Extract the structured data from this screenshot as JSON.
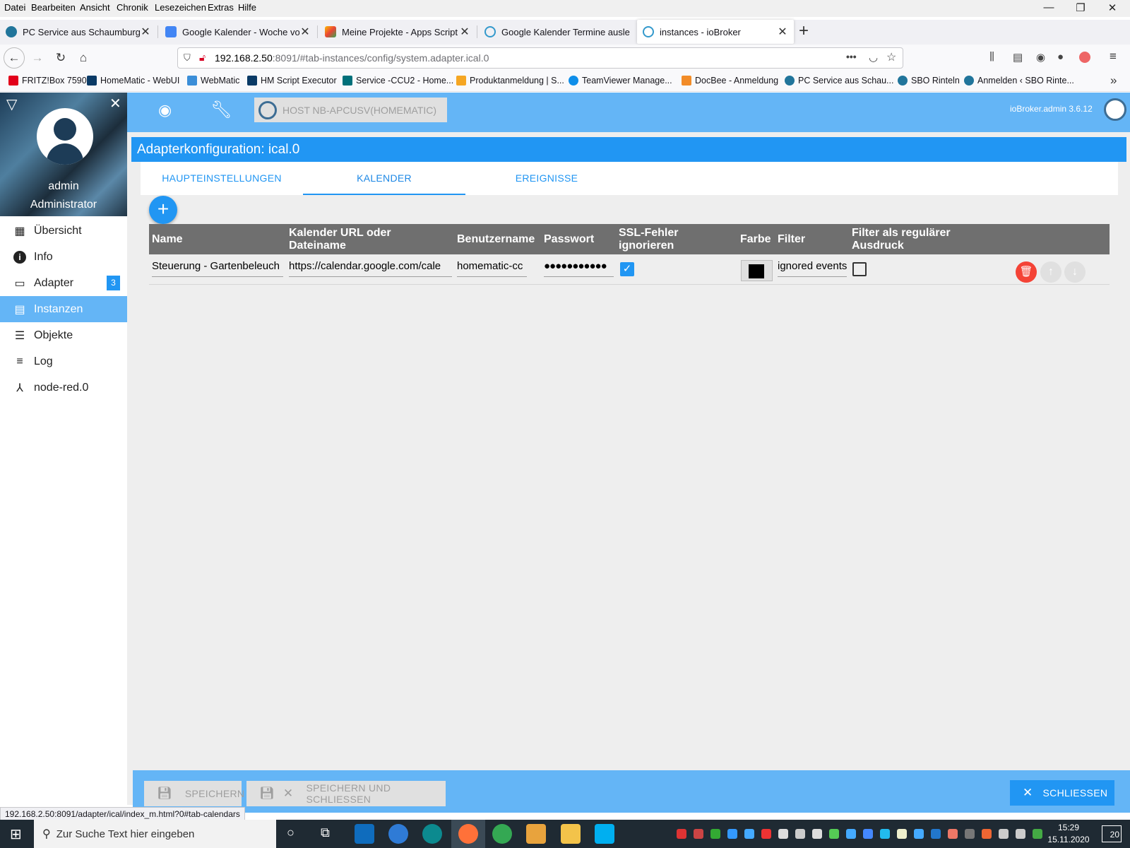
{
  "menubar": {
    "items": [
      "Datei",
      "Bearbeiten",
      "Ansicht",
      "Chronik",
      "Lesezeichen",
      "Extras",
      "Hilfe"
    ]
  },
  "window_controls": {
    "minimize": "—",
    "restore": "❐",
    "close": "✕"
  },
  "tabs": [
    {
      "title": "PC Service aus Schaumburg",
      "icon": "wordpress-icon",
      "color": "#21759b"
    },
    {
      "title": "Google Kalender - Woche vom",
      "icon": "google-calendar-icon",
      "color": "#4285f4"
    },
    {
      "title": "Meine Projekte - Apps Script",
      "icon": "apps-script-icon",
      "color": "#fbbc04"
    },
    {
      "title": "Google Kalender Termine ausle",
      "icon": "iobroker-icon",
      "color": "#3399cc"
    },
    {
      "title": "instances - ioBroker",
      "icon": "iobroker-icon",
      "color": "#3399cc"
    }
  ],
  "new_tab": "+",
  "navbar": {
    "url_host": "192.168.2.50",
    "url_rest": ":8091/#tab-instances/config/system.adapter.ical.0",
    "more": "•••"
  },
  "bookmarks": [
    {
      "label": "FRITZ!Box 7590",
      "color": "#e2001a"
    },
    {
      "label": "HomeMatic - WebUI",
      "color": "#0a3a66"
    },
    {
      "label": "WebMatic",
      "color": "#3b8ed8"
    },
    {
      "label": "HM Script Executor",
      "color": "#0a3a66"
    },
    {
      "label": "Service -CCU2 - Home...",
      "color": "#00707a"
    },
    {
      "label": "Produktanmeldung | S...",
      "color": "#f5a623"
    },
    {
      "label": "TeamViewer Manage...",
      "color": "#0e8ee9"
    },
    {
      "label": "DocBee - Anmeldung",
      "color": "#f28c28"
    },
    {
      "label": "PC Service aus Schau...",
      "color": "#21759b"
    },
    {
      "label": "SBO Rinteln",
      "color": "#21759b"
    },
    {
      "label": "Anmelden ‹ SBO Rinte...",
      "color": "#21759b"
    }
  ],
  "sidebar": {
    "user": "admin",
    "role": "Administrator",
    "items": [
      {
        "label": "Übersicht",
        "icon": "grid-icon"
      },
      {
        "label": "Info",
        "icon": "info-icon"
      },
      {
        "label": "Adapter",
        "icon": "store-icon",
        "badge": "3"
      },
      {
        "label": "Instanzen",
        "icon": "instances-icon",
        "active": true
      },
      {
        "label": "Objekte",
        "icon": "list-icon"
      },
      {
        "label": "Log",
        "icon": "log-icon"
      },
      {
        "label": "node-red.0",
        "icon": "node-red-icon"
      }
    ]
  },
  "header": {
    "host": "HOST NB-APCUSV(HOMEMATIC)",
    "version": "ioBroker.admin 3.6.12"
  },
  "config": {
    "title": "Adapterkonfiguration: ical.0",
    "tabs": [
      "HAUPTEINSTELLUNGEN",
      "KALENDER",
      "EREIGNISSE"
    ],
    "selected_tab": "KALENDER",
    "add_label": "+",
    "columns": [
      {
        "line1": "Name",
        "line2": ""
      },
      {
        "line1": "Kalender URL oder",
        "line2": "Dateiname"
      },
      {
        "line1": "Benutzername",
        "line2": ""
      },
      {
        "line1": "Passwort",
        "line2": ""
      },
      {
        "line1": "SSL-Fehler",
        "line2": "ignorieren"
      },
      {
        "line1": "Farbe",
        "line2": ""
      },
      {
        "line1": "Filter",
        "line2": ""
      },
      {
        "line1": "Filter als regulärer",
        "line2": "Ausdruck"
      }
    ],
    "row": {
      "name": "Steuerung - Gartenbeleuch",
      "url": "https://calendar.google.com/cale",
      "user": "homematic-cc",
      "password": "●●●●●●●●●●●",
      "ssl_ignore": true,
      "color": "#000000",
      "filter": "ignored events",
      "filter_regex": false
    }
  },
  "footer": {
    "save": "SPEICHERN",
    "save_close": "SPEICHERN UND SCHLIESSEN",
    "close": "SCHLIESSEN"
  },
  "statusbar": "192.168.2.50:8091/adapter/ical/index_m.html?0#tab-calendars",
  "taskbar": {
    "search": "Zur Suche Text hier eingeben",
    "time": "15:29",
    "date": "15.11.2020",
    "notifications": "20"
  }
}
